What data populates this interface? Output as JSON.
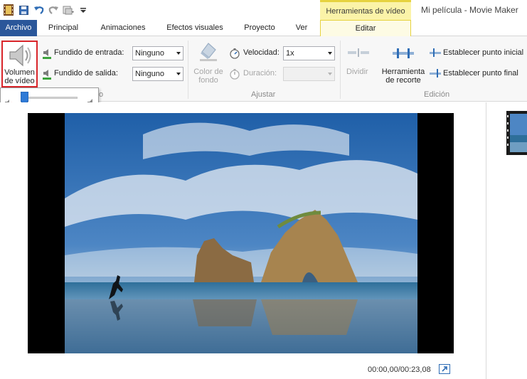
{
  "window": {
    "title": "Mi película - Movie Maker",
    "contextual_group": "Herramientas de vídeo"
  },
  "tabs": [
    "Archivo",
    "Principal",
    "Animaciones",
    "Efectos visuales",
    "Proyecto",
    "Ver",
    "Editar"
  ],
  "ribbon": {
    "volume_button": "Volumen de vídeo",
    "fade_in_label": "Fundido de entrada:",
    "fade_in_value": "Ninguno",
    "fade_out_label": "Fundido de salida:",
    "fade_out_value": "Ninguno",
    "group_audio_fragment": "o",
    "bg_color_label": "Color de fondo",
    "speed_label": "Velocidad:",
    "speed_value": "1x",
    "duration_label": "Duración:",
    "group_adjust": "Ajustar",
    "split_label": "Dividir",
    "trim_tool_label": "Herramienta de recorte",
    "set_start_label": "Establecer punto inicial",
    "set_end_label": "Establecer punto final",
    "group_edit": "Edición"
  },
  "volume_popup": {
    "level": 0.0
  },
  "player": {
    "time": "00:00,00/00:23,08"
  },
  "icons": [
    "film-icon",
    "save-icon",
    "undo-icon",
    "redo-icon",
    "publish-icon",
    "qat-menu-icon",
    "speaker-icon",
    "fade-in-icon",
    "fade-out-icon",
    "paint-bucket-icon",
    "speed-icon",
    "duration-icon",
    "split-icon",
    "trim-tool-icon",
    "set-start-icon",
    "set-end-icon",
    "mute-icon",
    "volume-max-icon",
    "expand-icon"
  ],
  "colors": {
    "file_tab": "#2b579a",
    "contextual": "#fbf3a8",
    "highlight_border": "#d9252a"
  }
}
